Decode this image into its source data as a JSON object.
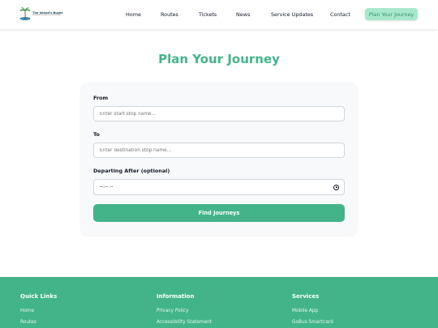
{
  "header": {
    "logo": {
      "title": "The Island's Buses",
      "subtitle": "Connecting Island Communities"
    },
    "nav": {
      "items": [
        {
          "label": "Home"
        },
        {
          "label": "Routes"
        },
        {
          "label": "Tickets"
        },
        {
          "label": "News"
        },
        {
          "label": "Service Updates"
        },
        {
          "label": "Contact"
        }
      ],
      "cta_label": "Plan Your Journey"
    }
  },
  "main": {
    "title": "Plan Your Journey",
    "form": {
      "from_label": "From",
      "from_placeholder": "Enter start stop name...",
      "to_label": "To",
      "to_placeholder": "Enter destination stop name...",
      "departing_label": "Departing After (optional)",
      "departing_value": "--:-- --",
      "submit_label": "Find Journeys"
    }
  },
  "footer": {
    "columns": [
      {
        "heading": "Quick Links",
        "links": [
          "Home",
          "Routes"
        ]
      },
      {
        "heading": "Information",
        "links": [
          "Privacy Policy",
          "Accessibility Statement"
        ]
      },
      {
        "heading": "Services",
        "links": [
          "Mobile App",
          "GoBus Smartcard"
        ]
      }
    ]
  },
  "colors": {
    "accent": "#43b48a",
    "cta_background": "#a7e8cc",
    "footer_background": "#43b48a"
  },
  "icons": {
    "logo": "palm-tree-island-icon",
    "time_picker": "clock-icon"
  }
}
